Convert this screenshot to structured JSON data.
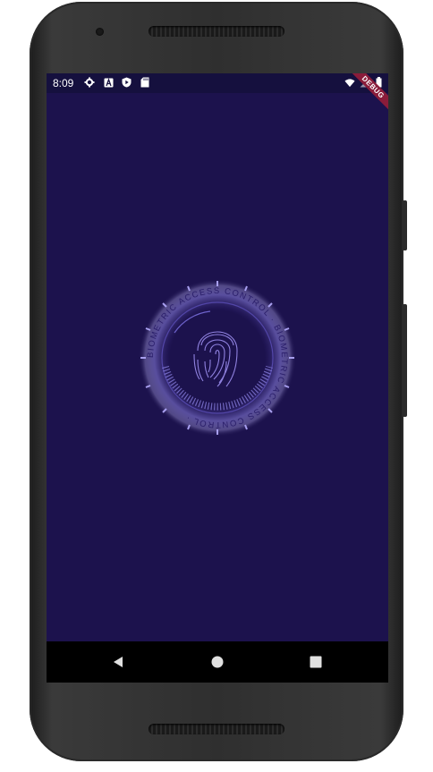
{
  "status_bar": {
    "time": "8:09",
    "left_icons": [
      "gear-icon",
      "font-a-icon",
      "shield-play-icon",
      "sd-card-icon"
    ],
    "right_icons": [
      "wifi-icon",
      "signal-icon",
      "battery-icon"
    ]
  },
  "debug_banner": "DEBUG",
  "emblem": {
    "ring_text": "BIOMETRIC ACCESS CONTROL · BIOMETRIC ACCESS CONTROL ·",
    "center_icon": "fingerprint-icon"
  },
  "nav_bar": {
    "buttons": [
      "back-icon",
      "home-icon",
      "recents-icon"
    ]
  },
  "colors": {
    "screen_bg": "#1c124d",
    "status_bg": "#15103e",
    "accent": "#7b6fd6",
    "debug_banner": "#8a1c3a"
  }
}
